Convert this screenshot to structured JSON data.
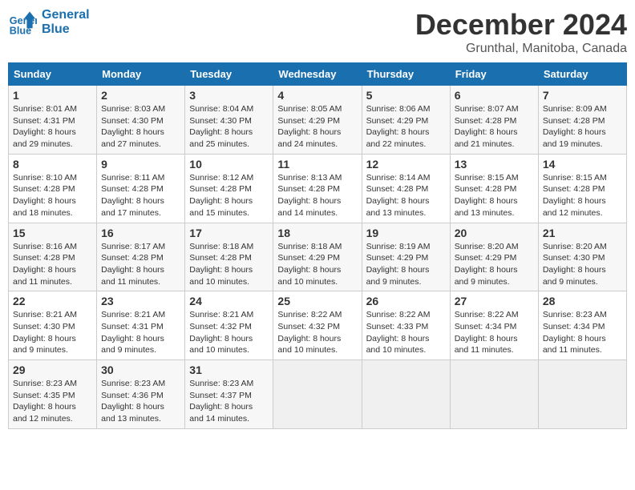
{
  "header": {
    "logo_line1": "General",
    "logo_line2": "Blue",
    "month": "December 2024",
    "location": "Grunthal, Manitoba, Canada"
  },
  "days_of_week": [
    "Sunday",
    "Monday",
    "Tuesday",
    "Wednesday",
    "Thursday",
    "Friday",
    "Saturday"
  ],
  "weeks": [
    [
      {
        "day": "1",
        "info": "Sunrise: 8:01 AM\nSunset: 4:31 PM\nDaylight: 8 hours\nand 29 minutes."
      },
      {
        "day": "2",
        "info": "Sunrise: 8:03 AM\nSunset: 4:30 PM\nDaylight: 8 hours\nand 27 minutes."
      },
      {
        "day": "3",
        "info": "Sunrise: 8:04 AM\nSunset: 4:30 PM\nDaylight: 8 hours\nand 25 minutes."
      },
      {
        "day": "4",
        "info": "Sunrise: 8:05 AM\nSunset: 4:29 PM\nDaylight: 8 hours\nand 24 minutes."
      },
      {
        "day": "5",
        "info": "Sunrise: 8:06 AM\nSunset: 4:29 PM\nDaylight: 8 hours\nand 22 minutes."
      },
      {
        "day": "6",
        "info": "Sunrise: 8:07 AM\nSunset: 4:28 PM\nDaylight: 8 hours\nand 21 minutes."
      },
      {
        "day": "7",
        "info": "Sunrise: 8:09 AM\nSunset: 4:28 PM\nDaylight: 8 hours\nand 19 minutes."
      }
    ],
    [
      {
        "day": "8",
        "info": "Sunrise: 8:10 AM\nSunset: 4:28 PM\nDaylight: 8 hours\nand 18 minutes."
      },
      {
        "day": "9",
        "info": "Sunrise: 8:11 AM\nSunset: 4:28 PM\nDaylight: 8 hours\nand 17 minutes."
      },
      {
        "day": "10",
        "info": "Sunrise: 8:12 AM\nSunset: 4:28 PM\nDaylight: 8 hours\nand 15 minutes."
      },
      {
        "day": "11",
        "info": "Sunrise: 8:13 AM\nSunset: 4:28 PM\nDaylight: 8 hours\nand 14 minutes."
      },
      {
        "day": "12",
        "info": "Sunrise: 8:14 AM\nSunset: 4:28 PM\nDaylight: 8 hours\nand 13 minutes."
      },
      {
        "day": "13",
        "info": "Sunrise: 8:15 AM\nSunset: 4:28 PM\nDaylight: 8 hours\nand 13 minutes."
      },
      {
        "day": "14",
        "info": "Sunrise: 8:15 AM\nSunset: 4:28 PM\nDaylight: 8 hours\nand 12 minutes."
      }
    ],
    [
      {
        "day": "15",
        "info": "Sunrise: 8:16 AM\nSunset: 4:28 PM\nDaylight: 8 hours\nand 11 minutes."
      },
      {
        "day": "16",
        "info": "Sunrise: 8:17 AM\nSunset: 4:28 PM\nDaylight: 8 hours\nand 11 minutes."
      },
      {
        "day": "17",
        "info": "Sunrise: 8:18 AM\nSunset: 4:28 PM\nDaylight: 8 hours\nand 10 minutes."
      },
      {
        "day": "18",
        "info": "Sunrise: 8:18 AM\nSunset: 4:29 PM\nDaylight: 8 hours\nand 10 minutes."
      },
      {
        "day": "19",
        "info": "Sunrise: 8:19 AM\nSunset: 4:29 PM\nDaylight: 8 hours\nand 9 minutes."
      },
      {
        "day": "20",
        "info": "Sunrise: 8:20 AM\nSunset: 4:29 PM\nDaylight: 8 hours\nand 9 minutes."
      },
      {
        "day": "21",
        "info": "Sunrise: 8:20 AM\nSunset: 4:30 PM\nDaylight: 8 hours\nand 9 minutes."
      }
    ],
    [
      {
        "day": "22",
        "info": "Sunrise: 8:21 AM\nSunset: 4:30 PM\nDaylight: 8 hours\nand 9 minutes."
      },
      {
        "day": "23",
        "info": "Sunrise: 8:21 AM\nSunset: 4:31 PM\nDaylight: 8 hours\nand 9 minutes."
      },
      {
        "day": "24",
        "info": "Sunrise: 8:21 AM\nSunset: 4:32 PM\nDaylight: 8 hours\nand 10 minutes."
      },
      {
        "day": "25",
        "info": "Sunrise: 8:22 AM\nSunset: 4:32 PM\nDaylight: 8 hours\nand 10 minutes."
      },
      {
        "day": "26",
        "info": "Sunrise: 8:22 AM\nSunset: 4:33 PM\nDaylight: 8 hours\nand 10 minutes."
      },
      {
        "day": "27",
        "info": "Sunrise: 8:22 AM\nSunset: 4:34 PM\nDaylight: 8 hours\nand 11 minutes."
      },
      {
        "day": "28",
        "info": "Sunrise: 8:23 AM\nSunset: 4:34 PM\nDaylight: 8 hours\nand 11 minutes."
      }
    ],
    [
      {
        "day": "29",
        "info": "Sunrise: 8:23 AM\nSunset: 4:35 PM\nDaylight: 8 hours\nand 12 minutes."
      },
      {
        "day": "30",
        "info": "Sunrise: 8:23 AM\nSunset: 4:36 PM\nDaylight: 8 hours\nand 13 minutes."
      },
      {
        "day": "31",
        "info": "Sunrise: 8:23 AM\nSunset: 4:37 PM\nDaylight: 8 hours\nand 14 minutes."
      },
      null,
      null,
      null,
      null
    ]
  ]
}
